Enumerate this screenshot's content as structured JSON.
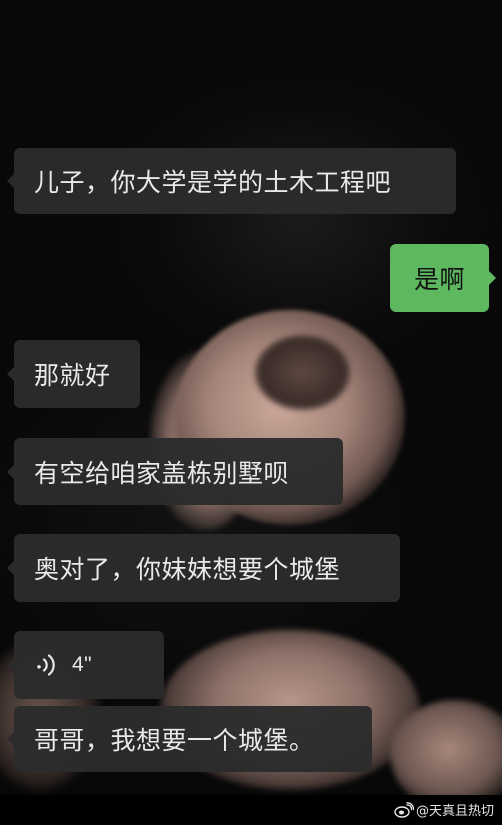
{
  "messages": [
    {
      "side": "incoming",
      "type": "text",
      "text": "儿子，你大学是学的土木工程吧"
    },
    {
      "side": "outgoing",
      "type": "text",
      "text": "是啊"
    },
    {
      "side": "incoming",
      "type": "text",
      "text": "那就好"
    },
    {
      "side": "incoming",
      "type": "text",
      "text": "有空给咱家盖栋别墅呗"
    },
    {
      "side": "incoming",
      "type": "text",
      "text": "奥对了，你妹妹想要个城堡"
    },
    {
      "side": "incoming",
      "type": "voice",
      "duration": "4\"",
      "icon": "voice-waves-icon"
    },
    {
      "side": "incoming",
      "type": "text",
      "text": "哥哥，我想要一个城堡。"
    }
  ],
  "watermark": {
    "text": "@天真且热切",
    "icon": "weibo-logo"
  },
  "colors": {
    "incoming_bubble": "#2c2c2c",
    "outgoing_bubble": "#5db860",
    "background": "#070707"
  }
}
